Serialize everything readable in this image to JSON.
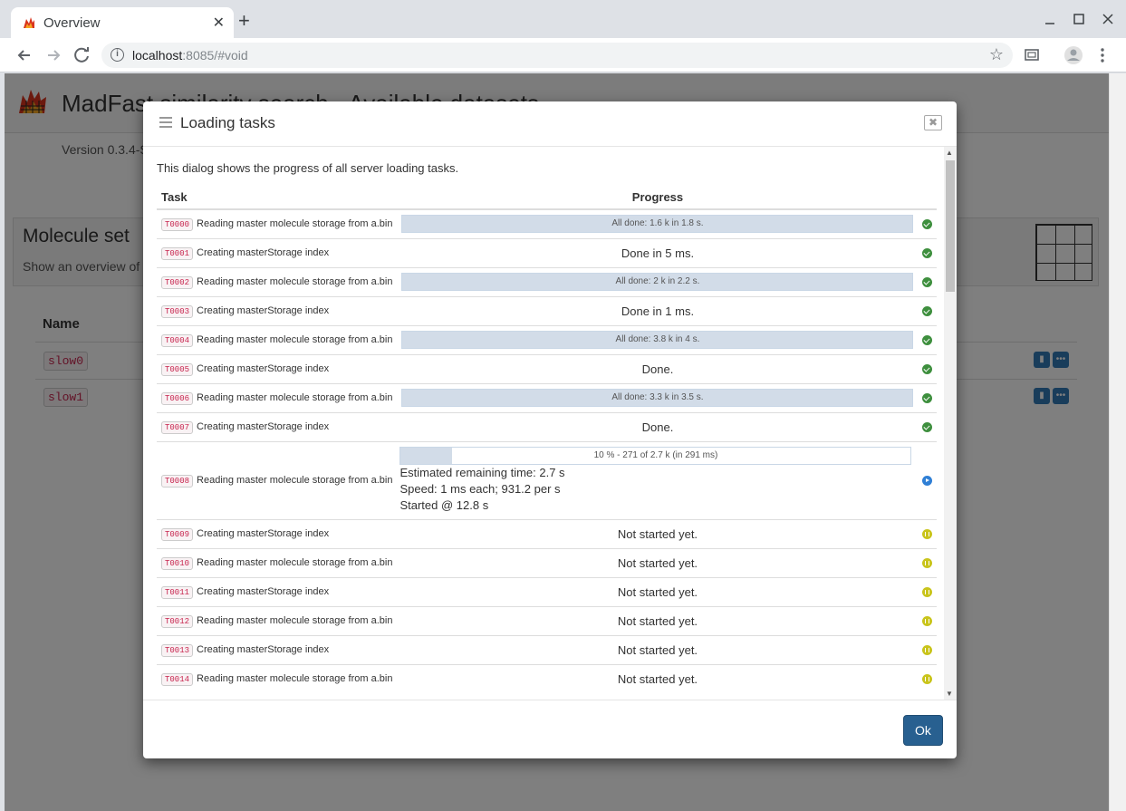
{
  "browser": {
    "tab_title": "Overview",
    "tab_close": "✕",
    "new_tab": "+",
    "url_host": "localhost",
    "url_rest": ":8085/#void"
  },
  "page": {
    "title": "MadFast similarity search - Available datasets",
    "version": "Version 0.3.4-S",
    "panel_title": "Molecule set",
    "panel_desc": "Show an overview of",
    "name_header": "Name",
    "datasets": [
      "slow0",
      "slow1"
    ]
  },
  "modal": {
    "title": "Loading tasks",
    "intro": "This dialog shows the progress of all server loading tasks.",
    "columns": {
      "task": "Task",
      "progress": "Progress"
    },
    "tasks": [
      {
        "id": "T0000",
        "name": "Reading master molecule storage from a.bin",
        "kind": "bar",
        "progress": 1.0,
        "text": "All done: 1.6 k in 1.8 s.",
        "status": "done"
      },
      {
        "id": "T0001",
        "name": "Creating masterStorage index",
        "kind": "text",
        "text": "Done in 5 ms.",
        "status": "done"
      },
      {
        "id": "T0002",
        "name": "Reading master molecule storage from a.bin",
        "kind": "bar",
        "progress": 1.0,
        "text": "All done: 2 k in 2.2 s.",
        "status": "done"
      },
      {
        "id": "T0003",
        "name": "Creating masterStorage index",
        "kind": "text",
        "text": "Done in 1 ms.",
        "status": "done"
      },
      {
        "id": "T0004",
        "name": "Reading master molecule storage from a.bin",
        "kind": "bar",
        "progress": 1.0,
        "text": "All done: 3.8 k in 4 s.",
        "status": "done"
      },
      {
        "id": "T0005",
        "name": "Creating masterStorage index",
        "kind": "text",
        "text": "Done.",
        "status": "done"
      },
      {
        "id": "T0006",
        "name": "Reading master molecule storage from a.bin",
        "kind": "bar",
        "progress": 1.0,
        "text": "All done: 3.3 k in 3.5 s.",
        "status": "done"
      },
      {
        "id": "T0007",
        "name": "Creating masterStorage index",
        "kind": "text",
        "text": "Done.",
        "status": "done"
      },
      {
        "id": "T0008",
        "name": "Reading master molecule storage from a.bin",
        "kind": "running",
        "progress": 0.1,
        "text": "10 % - 271 of 2.7 k (in 291 ms)",
        "details": [
          "Estimated remaining time: 2.7 s",
          "Speed: 1 ms each; 931.2 per s",
          "Started @ 12.8 s"
        ],
        "status": "running"
      },
      {
        "id": "T0009",
        "name": "Creating masterStorage index",
        "kind": "text",
        "text": "Not started yet.",
        "status": "waiting"
      },
      {
        "id": "T0010",
        "name": "Reading master molecule storage from a.bin",
        "kind": "text",
        "text": "Not started yet.",
        "status": "waiting"
      },
      {
        "id": "T0011",
        "name": "Creating masterStorage index",
        "kind": "text",
        "text": "Not started yet.",
        "status": "waiting"
      },
      {
        "id": "T0012",
        "name": "Reading master molecule storage from a.bin",
        "kind": "text",
        "text": "Not started yet.",
        "status": "waiting"
      },
      {
        "id": "T0013",
        "name": "Creating masterStorage index",
        "kind": "text",
        "text": "Not started yet.",
        "status": "waiting"
      },
      {
        "id": "T0014",
        "name": "Reading master molecule storage from a.bin",
        "kind": "text",
        "text": "Not started yet.",
        "status": "waiting"
      }
    ],
    "ok_label": "Ok"
  },
  "colors": {
    "done": "#3e8f3e",
    "running": "#2f7fd5",
    "waiting": "#c9c41b",
    "primary": "#286090"
  }
}
